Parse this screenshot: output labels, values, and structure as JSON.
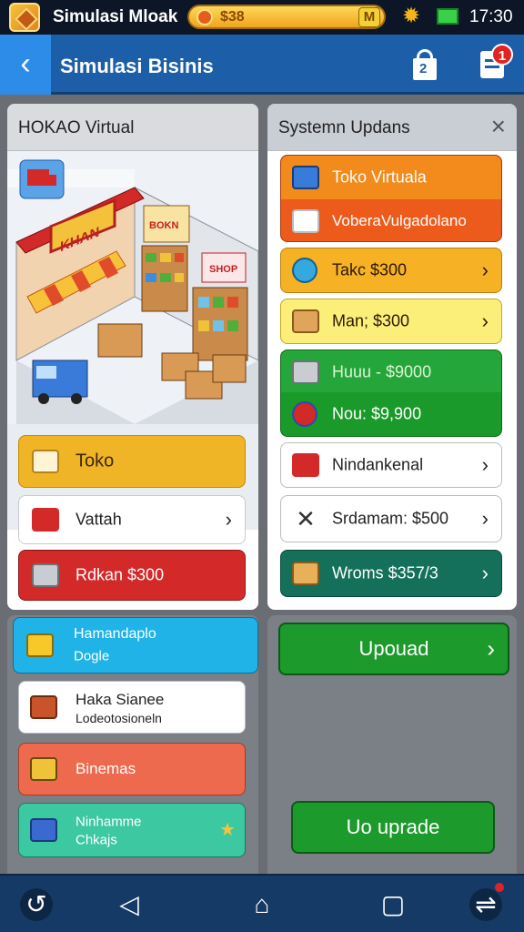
{
  "status_bar": {
    "app_name": "Simulasi Mloak",
    "coins": "$38",
    "coin_badge": "M",
    "time": "17:30"
  },
  "app_bar": {
    "title": "Simulasi Bisinis",
    "store_badge": "2",
    "cart_badge": "1"
  },
  "left_panel": {
    "title": "HOKAO Virtual",
    "scene_sign_main": "KHAN",
    "scene_sign_shelf": "BOKN",
    "scene_sign_side": "SHOP",
    "buttons": [
      {
        "label": "Toko",
        "icon": "box-icon"
      },
      {
        "label": "Vattah",
        "icon": "cart-icon"
      },
      {
        "label": "Rdkan $300",
        "icon": "crate-icon"
      }
    ]
  },
  "right_panel": {
    "title": "Systemn Updans",
    "items": [
      {
        "label": "Toko Virtuala",
        "icon": "truck-icon"
      },
      {
        "label": "VoberaVulgadolano",
        "icon": "box-icon"
      },
      {
        "label": "Takc $300",
        "icon": "ball-icon"
      },
      {
        "label": "Man; $300",
        "icon": "package-icon"
      },
      {
        "label": "Huuu - $9000",
        "icon": "crate-icon"
      },
      {
        "label": "Nou: $9,900",
        "icon": "globe-icon"
      },
      {
        "label": "Nindankenal",
        "icon": "cart-icon"
      },
      {
        "label": "Srdamam: $500",
        "icon": "tools-icon"
      },
      {
        "label": "Wroms $357/3",
        "icon": "package-icon"
      }
    ]
  },
  "lower_left": {
    "items": [
      {
        "title": "Hamandaplo",
        "subtitle": "Dogle"
      },
      {
        "title": "Haka Sianee",
        "subtitle": "Lodeotosioneln"
      },
      {
        "title": "Binemas",
        "subtitle": ""
      },
      {
        "title": "Ninhamme",
        "subtitle": "Chkajs"
      }
    ]
  },
  "lower_right": {
    "upgrade_label": "Upouad",
    "upgrade2_label": "Uo uprade"
  },
  "colors": {
    "orange": "#f07a14",
    "yellow": "#f9d84a",
    "green": "#15942a",
    "red": "#d32929",
    "blue": "#1c5ea8",
    "teal": "#14705a"
  }
}
